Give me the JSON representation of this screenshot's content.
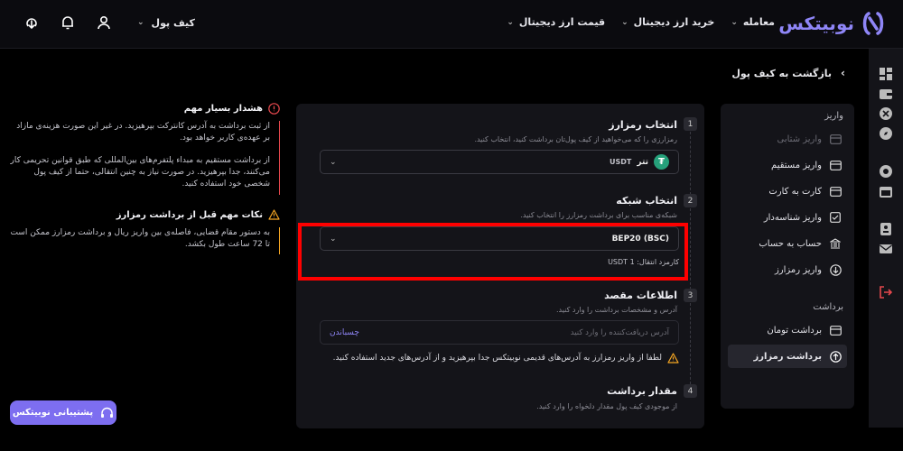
{
  "header": {
    "logo_text": "نوبیتکس",
    "nav": [
      {
        "label": "معامله"
      },
      {
        "label": "خرید ارز دیجیتال"
      },
      {
        "label": "قیمت ارز دیجیتال"
      }
    ],
    "wallet_label": "کیف پول"
  },
  "back_label": "بازگشت به کیف پول",
  "sidebar": {
    "deposit_section": "واریز",
    "deposit_items": [
      {
        "label": "واریز شتابی",
        "disabled": true
      },
      {
        "label": "واریز مستقیم"
      },
      {
        "label": "کارت به کارت"
      },
      {
        "label": "واریز شناسه‌دار"
      },
      {
        "label": "حساب به حساب"
      },
      {
        "label": "واریز رمزارز"
      }
    ],
    "withdraw_section": "برداشت",
    "withdraw_items": [
      {
        "label": "برداشت تومان"
      },
      {
        "label": "برداشت رمزارز",
        "active": true
      }
    ]
  },
  "form": {
    "step1": {
      "num": "1",
      "title": "انتخاب رمزارز",
      "subtitle": "رمزارزی را که می‌خواهید از کیف پول‌تان برداشت کنید، انتخاب کنید.",
      "value": "تتر",
      "symbol": "USDT"
    },
    "step2": {
      "num": "2",
      "title": "انتخاب شبکه",
      "subtitle": "شبکه‌ی مناسب برای برداشت رمزارز را انتخاب کنید.",
      "value": "BEP20 (BSC)",
      "fee": "کارمزد انتقال: 1 USDT"
    },
    "step3": {
      "num": "3",
      "title": "اطلاعات مقصد",
      "subtitle": "آدرس و مشخصات برداشت را وارد کنید.",
      "placeholder": "آدرس دریافت‌کننده را وارد کنید",
      "paste_label": "چسباندن",
      "warning": "لطفا از واریز رمزارز به آدرس‌های قدیمی نوبیتکس جدا بپرهیزید و از آدرس‌های جدید استفاده کنید."
    },
    "step4": {
      "num": "4",
      "title": "مقدار برداشت",
      "subtitle": "از موجودی کیف پول مقدار دلخواه را وارد کنید."
    }
  },
  "notes": {
    "warning_title": "هشدار بسیار مهم",
    "warning_p1": "از ثبت برداشت به آدرس کانترکت بپرهیزید. در غیر این صورت هزینه‌ی مازاد بر عهده‌ی کاربر خواهد بود.",
    "warning_p2": "از برداشت مستقیم به مبداء پلتفرم‌های بین‌المللی که طبق قوانین تحریمی کار می‌کنند، جدا بپرهیزید. در صورت نیاز به چنین انتقالی، حتما از کیف پول شخصی خود استفاده کنید.",
    "tips_title": "نکات مهم قبل از برداشت رمزارز",
    "tips_p1": "به دستور مقام قضایی، فاصله‌ی بین واریز ریال و برداشت رمزارز ممکن است تا 72 ساعت طول بکشد."
  },
  "support_label": "پشتیبانی نوبیتکس",
  "colors": {
    "accent": "#8f86f7",
    "danger": "#e5484d",
    "warning": "#f5a623",
    "highlight": "#ff0000"
  }
}
